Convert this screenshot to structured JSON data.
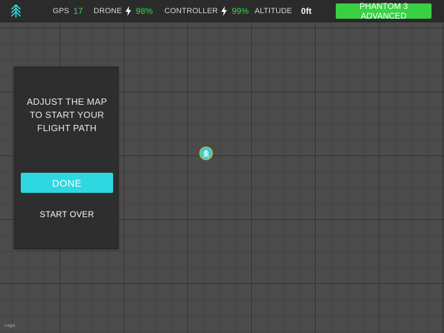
{
  "topbar": {
    "logo_icon": "tree-logo-icon",
    "gps": {
      "label": "GPS",
      "value": "17"
    },
    "drone": {
      "label": "DRONE",
      "icon": "lightning-bolt-icon",
      "value": "98%"
    },
    "controller": {
      "label": "CONTROLLER",
      "icon": "lightning-bolt-icon",
      "value": "99%"
    },
    "altitude": {
      "label": "ALTITUDE",
      "value": "0ft"
    },
    "model_button_label": "PHANTOM 3 ADVANCED"
  },
  "panel": {
    "message_lines": [
      "ADJUST THE MAP",
      "TO START YOUR",
      "FLIGHT PATH"
    ],
    "done_label": "DONE",
    "start_over_label": "START OVER"
  },
  "map": {
    "marker_icon": "tree-location-marker-icon",
    "legal_label": "Legal"
  },
  "colors": {
    "accent_green": "#3ad044",
    "accent_cyan": "#2fd8e0",
    "topbar_bg": "#2b2b2b",
    "panel_bg": "#2e2e2e",
    "map_bg": "#4b4b4b"
  }
}
